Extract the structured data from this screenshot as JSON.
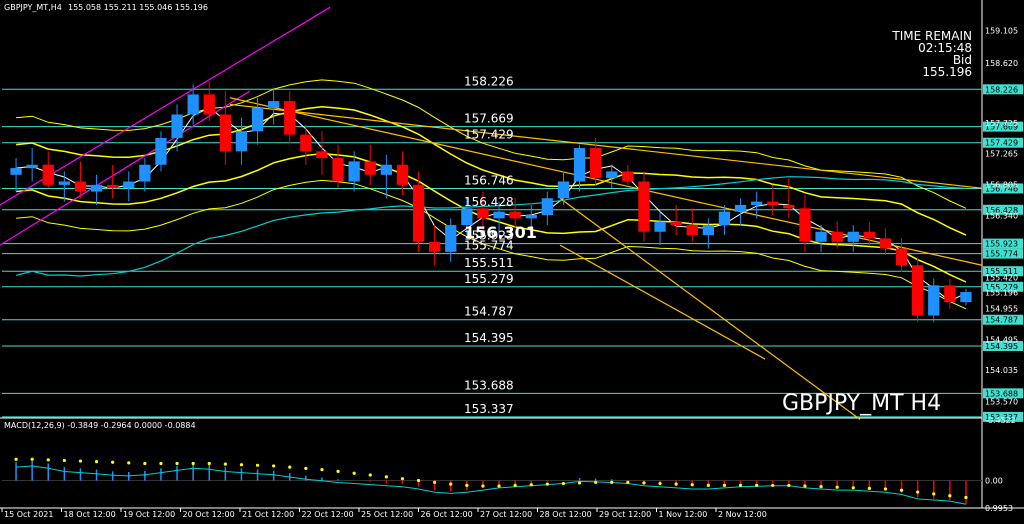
{
  "header": {
    "symbol_text": "GBPJPY_MT,H4",
    "ohlc_text": "155.058 155.211 155.046 155.196"
  },
  "hud": {
    "time_remain_label": "TIME REMAIN",
    "time_remain_value": "02:15:48",
    "bid_label": "Bid",
    "bid_value": "155.196"
  },
  "watermark": "GBPJPY_MT H4",
  "current_price_marker": "156.301",
  "macd": {
    "label": "MACD(12,26,9) -0.3849 -0.2964 0.0000 -0.0884",
    "scale": [
      "0.9953",
      "0.00",
      "-0.4522"
    ]
  },
  "colors": {
    "background": "#000000",
    "bull": "#1e90ff",
    "bear": "#ff0000",
    "level": "#40e0d0",
    "band": "#ffff00",
    "trend": "#ffc000",
    "channel": "#ff00ff",
    "ma_slow": "#00ced1",
    "signal_dots": "#ffff00",
    "macd_hist": "#ff0000"
  },
  "chart_data": [
    {
      "type": "candlestick",
      "title": "GBPJPY_MT,H4",
      "ylim": [
        153.35,
        159.35
      ],
      "y_ticks": [
        "159.105",
        "158.620",
        "158.226",
        "157.725",
        "157.669",
        "157.429",
        "157.265",
        "156.805",
        "156.746",
        "156.428",
        "156.340",
        "155.923",
        "155.774",
        "155.511",
        "155.420",
        "155.279",
        "155.196",
        "154.955",
        "154.787",
        "154.495",
        "154.395",
        "154.035",
        "153.688",
        "153.570"
      ],
      "x_ticks": [
        "15 Oct 2021",
        "18 Oct 12:00",
        "19 Oct 12:00",
        "20 Oct 12:00",
        "21 Oct 12:00",
        "22 Oct 12:00",
        "25 Oct 12:00",
        "26 Oct 12:00",
        "27 Oct 12:00",
        "28 Oct 12:00",
        "29 Oct 12:00",
        "1 Nov 12:00",
        "2 Nov 12:00"
      ],
      "levels": [
        "158.226",
        "157.669",
        "157.429",
        "156.746",
        "156.428",
        "155.923",
        "155.774",
        "155.511",
        "155.279",
        "154.787",
        "154.395",
        "153.688",
        "153.337"
      ],
      "candles": [
        [
          156.95,
          157.2,
          156.7,
          157.05
        ],
        [
          157.05,
          157.35,
          156.85,
          157.1
        ],
        [
          157.1,
          157.3,
          156.75,
          156.8
        ],
        [
          156.8,
          157.0,
          156.55,
          156.85
        ],
        [
          156.85,
          157.15,
          156.6,
          156.7
        ],
        [
          156.7,
          156.95,
          156.5,
          156.8
        ],
        [
          156.8,
          157.1,
          156.6,
          156.75
        ],
        [
          156.75,
          157.0,
          156.55,
          156.85
        ],
        [
          156.85,
          157.2,
          156.7,
          157.1
        ],
        [
          157.1,
          157.6,
          157.0,
          157.5
        ],
        [
          157.5,
          158.0,
          157.3,
          157.85
        ],
        [
          157.85,
          158.3,
          157.7,
          158.15
        ],
        [
          158.15,
          158.35,
          157.75,
          157.85
        ],
        [
          157.85,
          158.2,
          157.1,
          157.3
        ],
        [
          157.3,
          157.8,
          157.1,
          157.6
        ],
        [
          157.6,
          158.1,
          157.4,
          157.95
        ],
        [
          157.95,
          158.25,
          157.7,
          158.05
        ],
        [
          158.05,
          158.2,
          157.4,
          157.55
        ],
        [
          157.55,
          157.7,
          157.1,
          157.3
        ],
        [
          157.3,
          157.6,
          156.95,
          157.2
        ],
        [
          157.2,
          157.4,
          156.75,
          156.85
        ],
        [
          156.85,
          157.3,
          156.7,
          157.15
        ],
        [
          157.15,
          157.4,
          156.8,
          156.95
        ],
        [
          156.95,
          157.25,
          156.6,
          157.1
        ],
        [
          157.1,
          157.3,
          156.65,
          156.8
        ],
        [
          156.8,
          157.0,
          155.8,
          155.95
        ],
        [
          155.95,
          156.2,
          155.6,
          155.8
        ],
        [
          155.8,
          156.3,
          155.65,
          156.2
        ],
        [
          156.2,
          156.6,
          156.05,
          156.45
        ],
        [
          156.45,
          156.7,
          156.1,
          156.3
        ],
        [
          156.3,
          156.55,
          156.05,
          156.4
        ],
        [
          156.4,
          156.6,
          156.15,
          156.3
        ],
        [
          156.3,
          156.5,
          156.1,
          156.35
        ],
        [
          156.35,
          156.7,
          156.2,
          156.6
        ],
        [
          156.6,
          157.0,
          156.5,
          156.85
        ],
        [
          156.85,
          157.4,
          156.7,
          157.35
        ],
        [
          157.35,
          157.5,
          156.8,
          156.9
        ],
        [
          156.9,
          157.1,
          156.75,
          157.0
        ],
        [
          157.0,
          157.1,
          156.8,
          156.85
        ],
        [
          156.85,
          157.0,
          155.95,
          156.1
        ],
        [
          156.1,
          156.4,
          155.9,
          156.25
        ],
        [
          156.25,
          156.5,
          156.05,
          156.2
        ],
        [
          156.2,
          156.45,
          155.95,
          156.05
        ],
        [
          156.05,
          156.3,
          155.85,
          156.2
        ],
        [
          156.2,
          156.5,
          156.05,
          156.4
        ],
        [
          156.4,
          156.6,
          156.2,
          156.5
        ],
        [
          156.5,
          156.7,
          156.3,
          156.55
        ],
        [
          156.55,
          156.8,
          156.35,
          156.5
        ],
        [
          156.5,
          156.9,
          156.3,
          156.45
        ],
        [
          156.45,
          156.65,
          155.8,
          155.95
        ],
        [
          155.95,
          156.2,
          155.8,
          156.1
        ],
        [
          156.1,
          156.25,
          155.85,
          155.95
        ],
        [
          155.95,
          156.2,
          155.8,
          156.1
        ],
        [
          156.1,
          156.25,
          155.9,
          156.0
        ],
        [
          156.0,
          156.15,
          155.75,
          155.85
        ],
        [
          155.85,
          156.0,
          155.5,
          155.6
        ],
        [
          155.6,
          155.7,
          154.75,
          154.85
        ],
        [
          154.85,
          155.4,
          154.75,
          155.3
        ],
        [
          155.3,
          155.4,
          154.95,
          155.05
        ],
        [
          155.05,
          155.25,
          155.0,
          155.2
        ]
      ]
    },
    {
      "type": "macd",
      "title": "MACD(12,26,9)",
      "ylim": [
        -0.4522,
        0.9953
      ],
      "histogram": [
        0.3,
        0.32,
        0.28,
        0.22,
        0.2,
        0.18,
        0.15,
        0.14,
        0.16,
        0.2,
        0.24,
        0.28,
        0.26,
        0.22,
        0.2,
        0.18,
        0.16,
        0.12,
        0.08,
        0.05,
        0.02,
        0.0,
        -0.02,
        -0.04,
        -0.06,
        -0.1,
        -0.16,
        -0.18,
        -0.16,
        -0.12,
        -0.08,
        -0.06,
        -0.04,
        -0.02,
        0.0,
        0.04,
        0.03,
        0.02,
        0.0,
        -0.04,
        -0.06,
        -0.08,
        -0.1,
        -0.1,
        -0.08,
        -0.06,
        -0.05,
        -0.04,
        -0.04,
        -0.08,
        -0.1,
        -0.12,
        -0.12,
        -0.14,
        -0.16,
        -0.2,
        -0.28,
        -0.3,
        -0.32,
        -0.38
      ],
      "signal": [
        0.35,
        0.35,
        0.34,
        0.33,
        0.32,
        0.31,
        0.3,
        0.29,
        0.28,
        0.28,
        0.28,
        0.28,
        0.28,
        0.27,
        0.26,
        0.25,
        0.24,
        0.22,
        0.2,
        0.18,
        0.15,
        0.12,
        0.09,
        0.06,
        0.03,
        0.0,
        -0.03,
        -0.06,
        -0.08,
        -0.09,
        -0.09,
        -0.08,
        -0.07,
        -0.06,
        -0.05,
        -0.04,
        -0.03,
        -0.03,
        -0.03,
        -0.04,
        -0.05,
        -0.06,
        -0.07,
        -0.08,
        -0.08,
        -0.08,
        -0.08,
        -0.08,
        -0.08,
        -0.09,
        -0.1,
        -0.11,
        -0.12,
        -0.13,
        -0.14,
        -0.16,
        -0.19,
        -0.22,
        -0.25,
        -0.28
      ]
    }
  ]
}
